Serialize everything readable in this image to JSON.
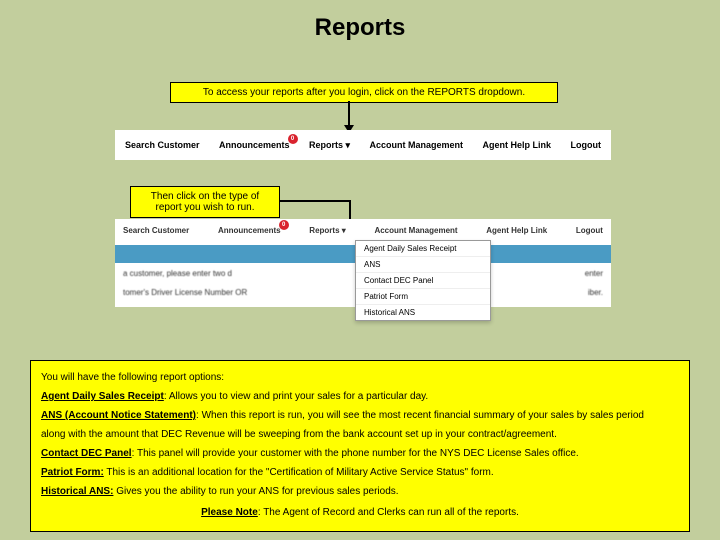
{
  "title": "Reports",
  "callout1": "To access your reports after you login, click on the REPORTS dropdown.",
  "callout2": "Then click on the type of report you wish to run.",
  "nav": {
    "search": "Search Customer",
    "announcements": "Announcements",
    "reports": "Reports",
    "reports_caret": "▾",
    "account": "Account Management",
    "help": "Agent Help Link",
    "logout": "Logout",
    "badge": "0"
  },
  "nav2": {
    "search": "Search Customer",
    "announcements": "Announcements",
    "reports": "Reports ▾",
    "account": "Account Management",
    "help": "Agent Help Link",
    "logout": "Logout",
    "badge": "0"
  },
  "blur": {
    "left": "a customer, please enter two d",
    "right": "enter",
    "left2": "tomer's Driver License Number OR",
    "right2": "iber."
  },
  "dropdown": {
    "i0": "Agent Daily Sales Receipt",
    "i1": "ANS",
    "i2": "Contact DEC Panel",
    "i3": "Patriot Form",
    "i4": "Historical ANS"
  },
  "footer": {
    "intro": "You will have the following report options:",
    "l1a": "Agent Daily Sales Receipt",
    "l1b": ": Allows you to view and print your sales for a particular day.",
    "l2a": "ANS (Account Notice Statement)",
    "l2b": ": When this report is run, you will see the most recent financial summary of your sales by sales period",
    "l2c": "along with the amount that DEC Revenue will be sweeping from the bank account set up in your contract/agreement.",
    "l3a": "Contact DEC Panel",
    "l3b": ": This panel will provide your customer with the phone number for the NYS DEC License Sales office.",
    "l4a": "Patriot Form:",
    "l4b": " This is an additional location for the \"Certification of Military Active Service Status\" form.",
    "l5a": "Historical ANS:",
    "l5b": " Gives you the ability to run your ANS for previous sales periods.",
    "note_a": "Please Note",
    "note_b": ": The Agent of Record and Clerks can run all of the reports."
  }
}
